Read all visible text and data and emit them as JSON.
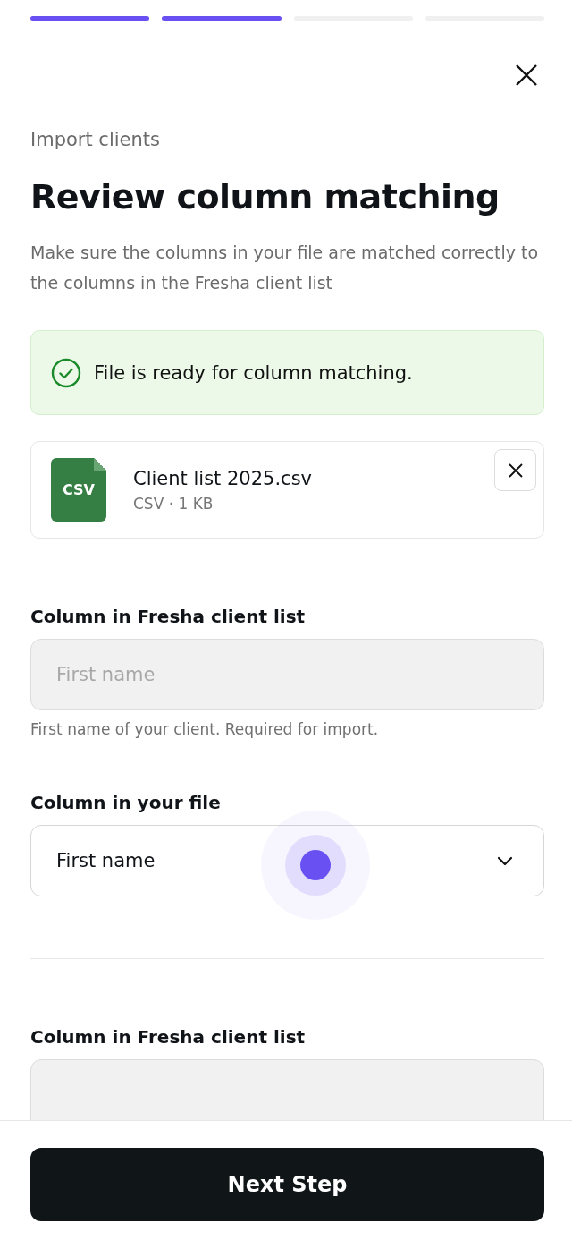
{
  "progress_steps": [
    {
      "completed": true
    },
    {
      "completed": true
    },
    {
      "completed": false
    },
    {
      "completed": false
    }
  ],
  "breadcrumb": "Import clients",
  "title": "Review column matching",
  "description": "Make sure the columns in your file are matched correctly to the columns in the Fresha client list",
  "alert": {
    "kind": "success",
    "text": "File is ready for column matching."
  },
  "file": {
    "badge": "CSV",
    "name": "Client list 2025.csv",
    "meta": "CSV · 1 KB"
  },
  "mappings": [
    {
      "fresha_label": "Column in Fresha client list",
      "fresha_placeholder": "First name",
      "helper": "First name of your client. Required for import.",
      "file_label": "Column in your file",
      "file_value": "First name"
    },
    {
      "fresha_label": "Column in Fresha client list"
    }
  ],
  "primary_button": "Next Step"
}
